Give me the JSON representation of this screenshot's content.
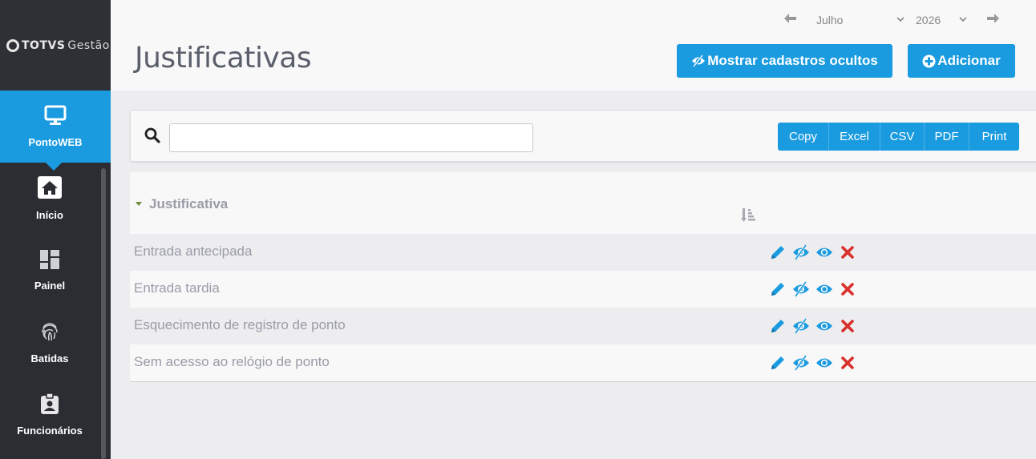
{
  "brand": {
    "name": "TOTVS",
    "product": "Gestão"
  },
  "sidebar": {
    "active": {
      "label": "PontoWEB",
      "icon": "monitor-icon"
    },
    "items": [
      {
        "label": "Início",
        "icon": "home-icon"
      },
      {
        "label": "Painel",
        "icon": "dashboard-icon"
      },
      {
        "label": "Batidas",
        "icon": "fingerprint-icon"
      },
      {
        "label": "Funcionários",
        "icon": "badge-icon"
      }
    ]
  },
  "header": {
    "title": "Justificativas",
    "month": "Julho",
    "year": "2026",
    "show_hidden_label": "Mostrar cadastros ocultos",
    "add_label": "Adicionar"
  },
  "search": {
    "value": "",
    "placeholder": ""
  },
  "export_buttons": [
    "Copy",
    "Excel",
    "CSV",
    "PDF",
    "Print"
  ],
  "table": {
    "column": "Justificativa",
    "rows": [
      "Entrada antecipada",
      "Entrada tardia",
      "Esquecimento de registro de ponto",
      "Sem acesso ao relógio de ponto"
    ]
  },
  "colors": {
    "accent": "#1a9be0",
    "sidebar": "#2b2d33",
    "delete": "#d9302b"
  }
}
